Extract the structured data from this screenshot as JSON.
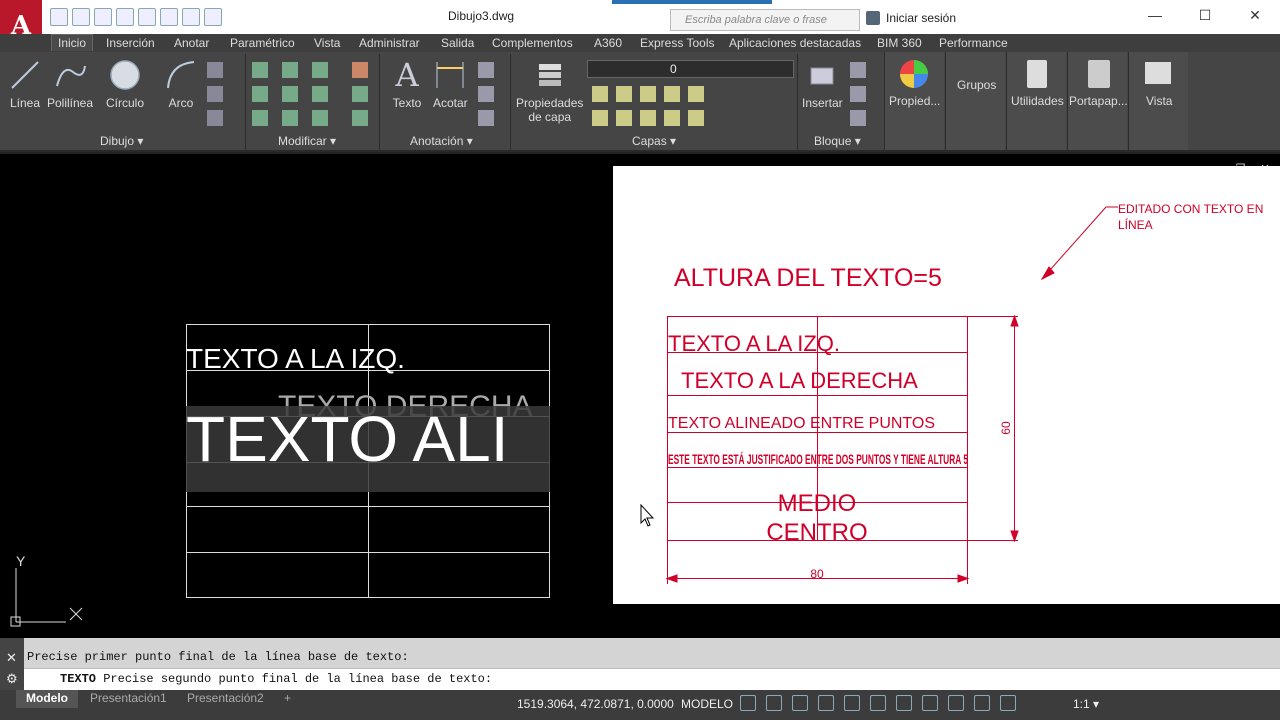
{
  "titlebar": {
    "app_letter": "A",
    "doc_title": "Dibujo3.dwg",
    "search_placeholder": "Escriba palabra clave o frase",
    "signin": "Iniciar sesión",
    "minimize": "—",
    "maximize": "☐",
    "close": "✕"
  },
  "tabs": [
    "Inicio",
    "Inserción",
    "Anotar",
    "Paramétrico",
    "Vista",
    "Administrar",
    "Salida",
    "Complementos",
    "A360",
    "Express Tools",
    "Aplicaciones destacadas",
    "BIM 360",
    "Performance"
  ],
  "ribbon": {
    "tools": {
      "linea": "Línea",
      "polilinea": "Polilínea",
      "circulo": "Círculo",
      "arco": "Arco",
      "texto": "Texto",
      "acotar": "Acotar",
      "prop_capa_1": "Propiedades",
      "prop_capa_2": "de capa",
      "insertar": "Insertar",
      "propied": "Propied...",
      "grupos": "Grupos",
      "utilidades": "Utilidades",
      "portapap": "Portapap...",
      "vista": "Vista"
    },
    "panels": {
      "dibujo": "Dibujo ▾",
      "modificar": "Modificar ▾",
      "anotacion": "Anotación ▾",
      "capas": "Capas ▾",
      "bloque": "Bloque ▾"
    },
    "layer_value": "0"
  },
  "model_space": {
    "row1": "TEXTO A LA IZQ.",
    "row2": "TEXTO DERECHA",
    "row3": "TEXTO ALI",
    "ucs_y": "Y",
    "ucs_x": "X"
  },
  "paper": {
    "title": "ALTURA DEL TEXTO=5",
    "note_line1": "EDITADO CON TEXTO EN",
    "note_line2": "LÍNEA",
    "row1": "TEXTO A LA IZQ.",
    "row2": "TEXTO A LA DERECHA",
    "row3": "TEXTO ALINEADO ENTRE PUNTOS",
    "row4": "ESTE TEXTO ESTÁ JUSTIFICADO ENTRE DOS PUNTOS Y TIENE ALTURA 5",
    "row5a": "MEDIO",
    "row5b": "CENTRO",
    "dim_height": "60",
    "dim_width": "80",
    "controls": "▭ ❐ ✕"
  },
  "command": {
    "history": "Precise primer punto final de la línea base de texto:",
    "keyword": "TEXTO",
    "prompt": "Precise segundo punto final de la línea base de texto:"
  },
  "statusbar": {
    "layouts": [
      "Modelo",
      "Presentación1",
      "Presentación2",
      "+"
    ],
    "coords": "1519.3064, 472.0871, 0.0000",
    "model": "MODELO",
    "scale": "1:1 ▾"
  },
  "colors": {
    "accent_red": "#d0002a",
    "brand_red": "#b8182a"
  }
}
